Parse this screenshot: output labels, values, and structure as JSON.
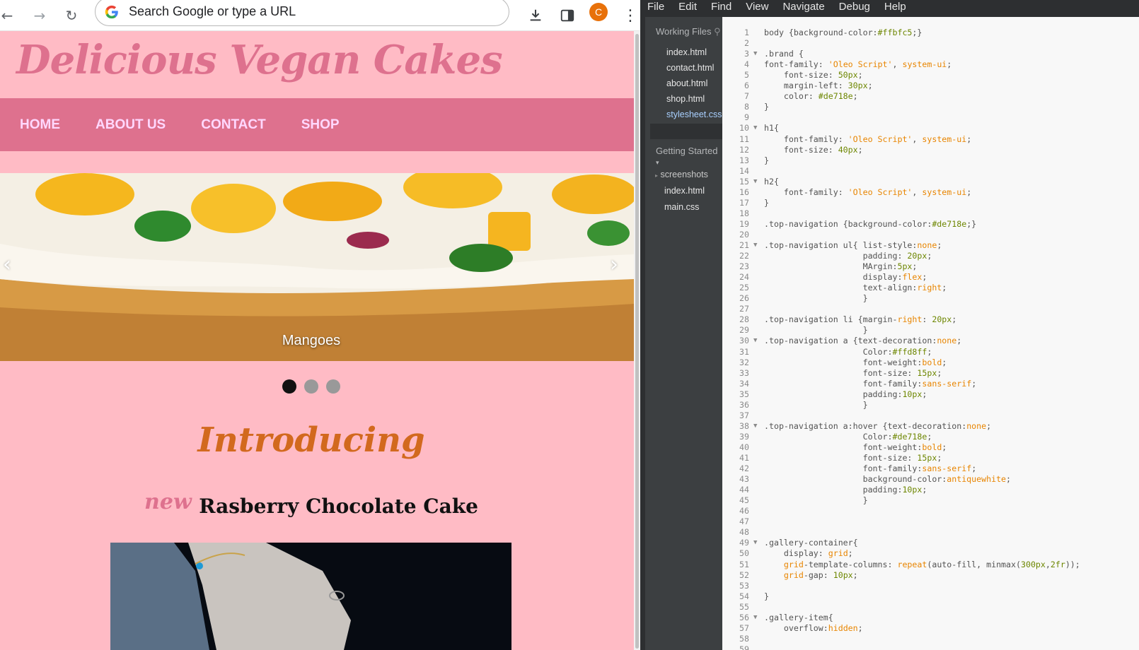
{
  "browser": {
    "back_icon": "arrow-left-icon",
    "forward_icon": "arrow-right-icon",
    "reload_icon": "reload-icon",
    "omnibox_placeholder": "Search Google or type a URL",
    "download_icon": "download-icon",
    "sidepanel_icon": "side-panel-icon",
    "profile_initial": "C",
    "menu_icon": "kebab-menu-icon"
  },
  "site": {
    "brand": "Delicious Vegan Cakes",
    "nav": [
      "HOME",
      "ABOUT US",
      "CONTACT",
      "SHOP"
    ],
    "slide_caption": "Mangoes",
    "prev_arrow": "‹",
    "next_arrow": "›",
    "dots_active": 0,
    "intro_heading": "Introducing",
    "new_label": "NEW",
    "cake_name": "Rasberry Chocolate Cake",
    "colors": {
      "bg": "#ffbbc5",
      "nav": "#de718e",
      "nav_text": "#ffd8ff",
      "intro": "#d2691e"
    }
  },
  "editor": {
    "menu": [
      "File",
      "Edit",
      "Find",
      "View",
      "Navigate",
      "Debug",
      "Help"
    ],
    "working_files_title": "Working Files",
    "working_files": [
      "index.html",
      "contact.html",
      "about.html",
      "shop.html",
      "stylesheet.css"
    ],
    "selected_file": "stylesheet.css",
    "project_title": "Getting Started",
    "project_items": [
      "screenshots",
      "index.html",
      "main.css"
    ],
    "code_lines": [
      "body {background-color:#ffbfc5;}",
      "",
      ".brand {",
      "font-family: 'Oleo Script', system-ui;",
      "    font-size: 50px;",
      "    margin-left: 30px;",
      "    color: #de718e;",
      "}",
      "",
      "h1{",
      "    font-family: 'Oleo Script', system-ui;",
      "    font-size: 40px;",
      "}",
      "",
      "h2{",
      "    font-family: 'Oleo Script', system-ui;",
      "}",
      "",
      ".top-navigation {background-color:#de718e;}",
      "",
      ".top-navigation ul{ list-style:none;",
      "                    padding: 20px;",
      "                    MArgin:5px;",
      "                    display:flex;",
      "                    text-align:right;",
      "                    }",
      "",
      ".top-navigation li {margin-right: 20px;",
      "                    }",
      ".top-navigation a {text-decoration:none;",
      "                    Color:#ffd8ff;",
      "                    font-weight:bold;",
      "                    font-size: 15px;",
      "                    font-family:sans-serif;",
      "                    padding:10px;",
      "                    }",
      "",
      ".top-navigation a:hover {text-decoration:none;",
      "                    Color:#de718e;",
      "                    font-weight:bold;",
      "                    font-size: 15px;",
      "                    font-family:sans-serif;",
      "                    background-color:antiquewhite;",
      "                    padding:10px;",
      "                    }",
      "",
      "",
      "",
      ".gallery-container{",
      "    display: grid;",
      "    grid-template-columns: repeat(auto-fill, minmax(300px,2fr));",
      "    grid-gap: 10px;",
      "",
      "}",
      "",
      ".gallery-item{",
      "    overflow:hidden;",
      "",
      ""
    ],
    "fold_lines": [
      3,
      10,
      15,
      21,
      30,
      38,
      49,
      56
    ]
  }
}
